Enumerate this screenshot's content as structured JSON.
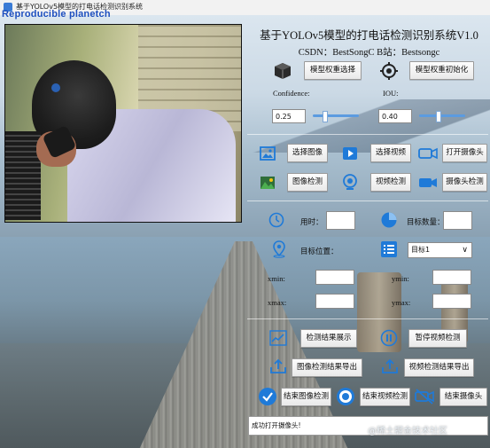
{
  "window": {
    "title": "基于YOLOv5模型的打电话检测识别系统",
    "watermark_top": "Reproducible planetch"
  },
  "header": {
    "title": "基于YOLOv5模型的打电话检测识别系统V1.0",
    "subtitle": "CSDN：BestSongC  B站：Bestsongc"
  },
  "model": {
    "select_weight_label": "模型权重选择",
    "init_weight_label": "模型权重初始化"
  },
  "params": {
    "confidence_label": "Confidence:",
    "iou_label": "IOU:",
    "confidence_value": "0.25",
    "iou_value": "0.40",
    "confidence_level": 0.25,
    "iou_level": 0.4,
    "accent_color": "#5b9be0"
  },
  "actions": {
    "select_image": "选择图像",
    "select_video": "选择视频",
    "open_camera": "打开摄像头",
    "image_detect": "图像检测",
    "video_detect": "视频检测",
    "camera_detect": "摄像头检测"
  },
  "results": {
    "time_label": "用时：",
    "time_value": "",
    "count_label": "目标数量：",
    "count_value": "",
    "target_position_label": "目标位置：",
    "target_select_value": "目标1",
    "xmin_label": "xmin:",
    "ymin_label": "ymin:",
    "xmax_label": "xmax:",
    "ymax_label": "ymax:",
    "xmin_value": "",
    "ymin_value": "",
    "xmax_value": "",
    "ymax_value": ""
  },
  "controls": {
    "show_results": "检测结果展示",
    "pause_video": "暂停视频检测",
    "export_image_results": "图像检测结果导出",
    "export_video_results": "视频检测结果导出",
    "end_image_detect": "结束图像检测",
    "end_video_detect": "结束视频检测",
    "end_camera": "结束摄像头"
  },
  "status": {
    "message": "成功打开摄像头!"
  },
  "watermark_bottom": "@稀土掘金技术社区",
  "icons": {
    "cube": "cube-icon",
    "target": "crosshair-icon",
    "image": "image-icon",
    "video": "video-play-icon",
    "camera": "camera-icon",
    "landscape": "landscape-icon",
    "webcam": "webcam-icon",
    "videocam": "videocam-icon",
    "clock": "clock-icon",
    "pie": "pie-chart-icon",
    "location": "location-pin-icon",
    "list": "list-select-icon",
    "chart": "line-chart-icon",
    "pause": "pause-icon",
    "upload": "upload-icon",
    "check": "check-circle-icon",
    "stop": "stop-circle-icon",
    "camera_off": "camera-off-icon"
  }
}
